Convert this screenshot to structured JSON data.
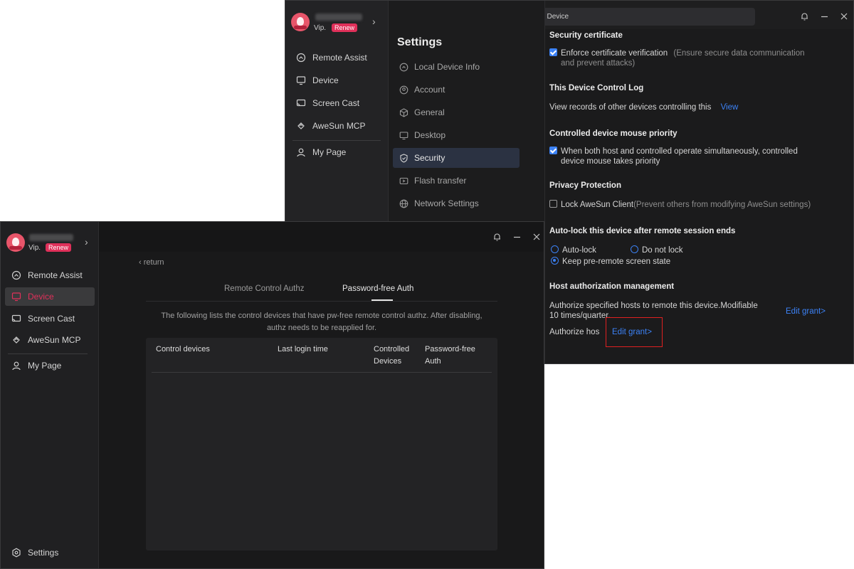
{
  "back_window": {
    "search_placeholder": "Search/Connect Device",
    "profile": {
      "vip": "Vip.",
      "renew": "Renew"
    },
    "nav": [
      {
        "label": "Remote Assist",
        "icon": "remote-assist-icon"
      },
      {
        "label": "Device",
        "icon": "monitor-icon"
      },
      {
        "label": "Screen Cast",
        "icon": "screen-cast-icon"
      },
      {
        "label": "AweSun MCP",
        "icon": "mcp-icon"
      },
      {
        "label": "My Page",
        "icon": "user-icon"
      }
    ],
    "settings": {
      "title": "Settings",
      "items": [
        {
          "label": "Local Device Info",
          "icon": "device-info-icon"
        },
        {
          "label": "Account",
          "icon": "account-icon"
        },
        {
          "label": "General",
          "icon": "cube-icon"
        },
        {
          "label": "Desktop",
          "icon": "desktop-icon"
        },
        {
          "label": "Security",
          "icon": "shield-icon",
          "active": true
        },
        {
          "label": "Flash transfer",
          "icon": "flash-transfer-icon"
        },
        {
          "label": "Network Settings",
          "icon": "globe-icon"
        }
      ]
    },
    "content": {
      "security_certificate": {
        "title": "Security certificate",
        "option": "Enforce certificate verification",
        "hint_line1": "(Ensure secure data communication",
        "hint_line2": "and prevent attacks)"
      },
      "control_log": {
        "title": "This Device Control Log",
        "text": "View records of other devices controlling this",
        "link": "View"
      },
      "mouse_priority": {
        "title": "Controlled device mouse priority",
        "line1": "When both host and controlled operate simultaneously, controlled",
        "line2": "device mouse takes priority"
      },
      "privacy": {
        "title": "Privacy Protection",
        "option": "Lock AweSun Client",
        "hint": "(Prevent others from modifying AweSun settings)"
      },
      "auto_lock": {
        "title": "Auto-lock this device after remote session ends",
        "opt1": "Auto-lock",
        "opt2": "Do not lock",
        "opt3": "Keep pre-remote screen state"
      },
      "host_auth": {
        "title": "Host authorization management",
        "line1": "Authorize specified hosts to remote this device.Modifiable",
        "line2": "10 times/quarter.",
        "link1": "Edit grant>",
        "line3": "Authorize hos",
        "link2": "Edit grant>"
      }
    }
  },
  "front_window": {
    "profile": {
      "vip": "Vip.",
      "renew": "Renew"
    },
    "nav": [
      {
        "label": "Remote Assist",
        "icon": "remote-assist-icon"
      },
      {
        "label": "Device",
        "icon": "monitor-icon",
        "active": true
      },
      {
        "label": "Screen Cast",
        "icon": "screen-cast-icon"
      },
      {
        "label": "AweSun MCP",
        "icon": "mcp-icon"
      },
      {
        "label": "My Page",
        "icon": "user-icon"
      }
    ],
    "settings_label": "Settings",
    "return_label": "return",
    "tabs": [
      "Remote Control Authz",
      "Password-free Auth"
    ],
    "note_line1": "The following lists the control devices that have pw-free remote control authz. After disabling,",
    "note_line2": "authz needs to be reapplied for.",
    "table_headers": {
      "col1": "Control devices",
      "col2": "Last login time",
      "col3_line1": "Controlled",
      "col3_line2": "Devices",
      "col4_line1": "Password-free",
      "col4_line2": "Auth"
    }
  },
  "colors": {
    "accent": "#e0305a",
    "link": "#3c82f6",
    "highlight_box": "#e02020"
  }
}
